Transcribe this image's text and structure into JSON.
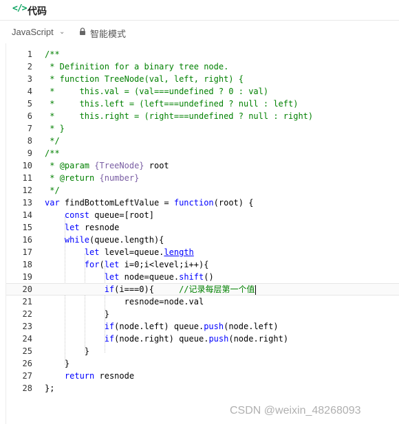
{
  "header": {
    "icon": "code-icon",
    "title": "代码"
  },
  "toolbar": {
    "language": "JavaScript",
    "mode": "智能模式"
  },
  "code": {
    "lines": [
      {
        "num": "1",
        "spans": [
          {
            "t": "c",
            "v": "/**"
          }
        ]
      },
      {
        "num": "2",
        "spans": [
          {
            "t": "c",
            "v": " * Definition for a binary tree node."
          }
        ]
      },
      {
        "num": "3",
        "spans": [
          {
            "t": "c",
            "v": " * function TreeNode(val, left, right) {"
          }
        ]
      },
      {
        "num": "4",
        "spans": [
          {
            "t": "c",
            "v": " *     this.val = (val===undefined ? 0 : val)"
          }
        ]
      },
      {
        "num": "5",
        "spans": [
          {
            "t": "c",
            "v": " *     this.left = (left===undefined ? null : left)"
          }
        ]
      },
      {
        "num": "6",
        "spans": [
          {
            "t": "c",
            "v": " *     this.right = (right===undefined ? null : right)"
          }
        ]
      },
      {
        "num": "7",
        "spans": [
          {
            "t": "c",
            "v": " * }"
          }
        ]
      },
      {
        "num": "8",
        "spans": [
          {
            "t": "c",
            "v": " */"
          }
        ]
      },
      {
        "num": "9",
        "spans": [
          {
            "t": "c",
            "v": "/**"
          }
        ]
      },
      {
        "num": "10",
        "spans": [
          {
            "t": "c",
            "v": " * "
          },
          {
            "t": "c",
            "v": "@param"
          },
          {
            "t": "c",
            "v": " "
          },
          {
            "t": "t",
            "v": "{TreeNode}"
          },
          {
            "t": "p",
            "v": " root"
          }
        ]
      },
      {
        "num": "11",
        "spans": [
          {
            "t": "c",
            "v": " * "
          },
          {
            "t": "c",
            "v": "@return"
          },
          {
            "t": "c",
            "v": " "
          },
          {
            "t": "t",
            "v": "{number}"
          }
        ]
      },
      {
        "num": "12",
        "spans": [
          {
            "t": "c",
            "v": " */"
          }
        ]
      },
      {
        "num": "13",
        "spans": [
          {
            "t": "k",
            "v": "var"
          },
          {
            "t": "p",
            "v": " findBottomLeftValue = "
          },
          {
            "t": "k",
            "v": "function"
          },
          {
            "t": "p",
            "v": "(root) {"
          }
        ]
      },
      {
        "num": "14",
        "spans": [
          {
            "t": "p",
            "v": "    "
          },
          {
            "t": "k",
            "v": "const"
          },
          {
            "t": "p",
            "v": " queue=[root]"
          }
        ]
      },
      {
        "num": "15",
        "spans": [
          {
            "t": "p",
            "v": "    "
          },
          {
            "t": "k",
            "v": "let"
          },
          {
            "t": "p",
            "v": " resnode"
          }
        ]
      },
      {
        "num": "16",
        "spans": [
          {
            "t": "p",
            "v": "    "
          },
          {
            "t": "k",
            "v": "while"
          },
          {
            "t": "p",
            "v": "(queue.length){"
          }
        ]
      },
      {
        "num": "17",
        "spans": [
          {
            "t": "p",
            "v": "        "
          },
          {
            "t": "k",
            "v": "let"
          },
          {
            "t": "p",
            "v": " level=queue."
          },
          {
            "t": "u",
            "v": "length"
          }
        ]
      },
      {
        "num": "18",
        "spans": [
          {
            "t": "p",
            "v": "        "
          },
          {
            "t": "k",
            "v": "for"
          },
          {
            "t": "p",
            "v": "("
          },
          {
            "t": "k",
            "v": "let"
          },
          {
            "t": "p",
            "v": " i=0;i<level;i++){"
          }
        ]
      },
      {
        "num": "19",
        "spans": [
          {
            "t": "p",
            "v": "            "
          },
          {
            "t": "k",
            "v": "let"
          },
          {
            "t": "p",
            "v": " node=queue."
          },
          {
            "t": "k",
            "v": "shift"
          },
          {
            "t": "p",
            "v": "()"
          }
        ]
      },
      {
        "num": "20",
        "spans": [
          {
            "t": "p",
            "v": "            "
          },
          {
            "t": "k",
            "v": "if"
          },
          {
            "t": "p",
            "v": "(i===0){     "
          },
          {
            "t": "c",
            "v": "//记录每层第一个值"
          }
        ]
      },
      {
        "num": "21",
        "spans": [
          {
            "t": "p",
            "v": "                resnode=node.val"
          }
        ]
      },
      {
        "num": "22",
        "spans": [
          {
            "t": "p",
            "v": "            }"
          }
        ]
      },
      {
        "num": "23",
        "spans": [
          {
            "t": "p",
            "v": "            "
          },
          {
            "t": "k",
            "v": "if"
          },
          {
            "t": "p",
            "v": "(node.left) queue."
          },
          {
            "t": "k",
            "v": "push"
          },
          {
            "t": "p",
            "v": "(node.left)"
          }
        ]
      },
      {
        "num": "24",
        "spans": [
          {
            "t": "p",
            "v": "            "
          },
          {
            "t": "k",
            "v": "if"
          },
          {
            "t": "p",
            "v": "(node.right) queue."
          },
          {
            "t": "k",
            "v": "push"
          },
          {
            "t": "p",
            "v": "(node.right)"
          }
        ]
      },
      {
        "num": "25",
        "spans": [
          {
            "t": "p",
            "v": "        }"
          }
        ]
      },
      {
        "num": "26",
        "spans": [
          {
            "t": "p",
            "v": "    }"
          }
        ]
      },
      {
        "num": "27",
        "spans": [
          {
            "t": "p",
            "v": "    "
          },
          {
            "t": "k",
            "v": "return"
          },
          {
            "t": "p",
            "v": " resnode"
          }
        ]
      },
      {
        "num": "28",
        "spans": [
          {
            "t": "p",
            "v": "};"
          }
        ]
      }
    ],
    "active_line": 20
  },
  "watermark": "CSDN @weixin_48268093",
  "colors": {
    "comment": "#008000",
    "keyword": "#0000ff",
    "type": "#795da3",
    "accent": "#0ba360"
  }
}
